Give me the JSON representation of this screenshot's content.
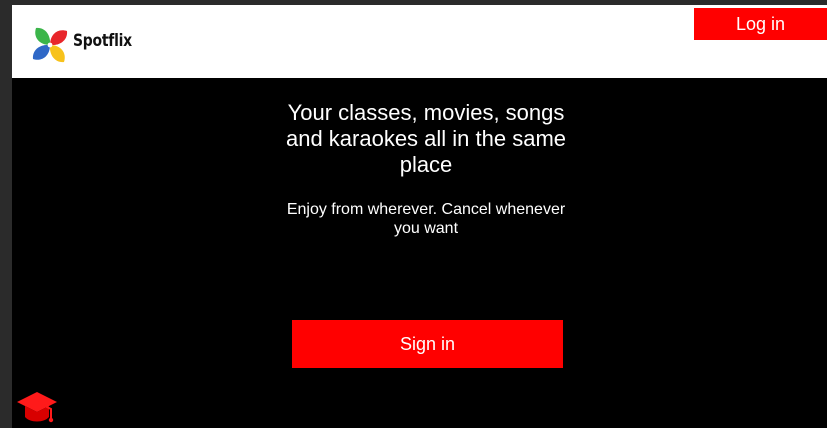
{
  "header": {
    "brand_name": "Spotflix",
    "login_label": "Log in",
    "logo_icon": "pinwheel-logo-icon"
  },
  "hero": {
    "title": "Your classes, movies, songs and karaokes all in the same place",
    "subtitle": "Enjoy from wherever. Cancel whenever you want",
    "signin_label": "Sign in"
  },
  "corner": {
    "icon": "graduation-cap-icon"
  },
  "colors": {
    "accent": "#ff0000",
    "navbar_bg": "#ffffff",
    "page_bg": "#000000",
    "outer_bg": "#2b2b2b",
    "logo_red": "#e8262b",
    "logo_green": "#3bb54a",
    "logo_blue": "#2f68c7",
    "logo_yellow": "#f7c21b"
  }
}
